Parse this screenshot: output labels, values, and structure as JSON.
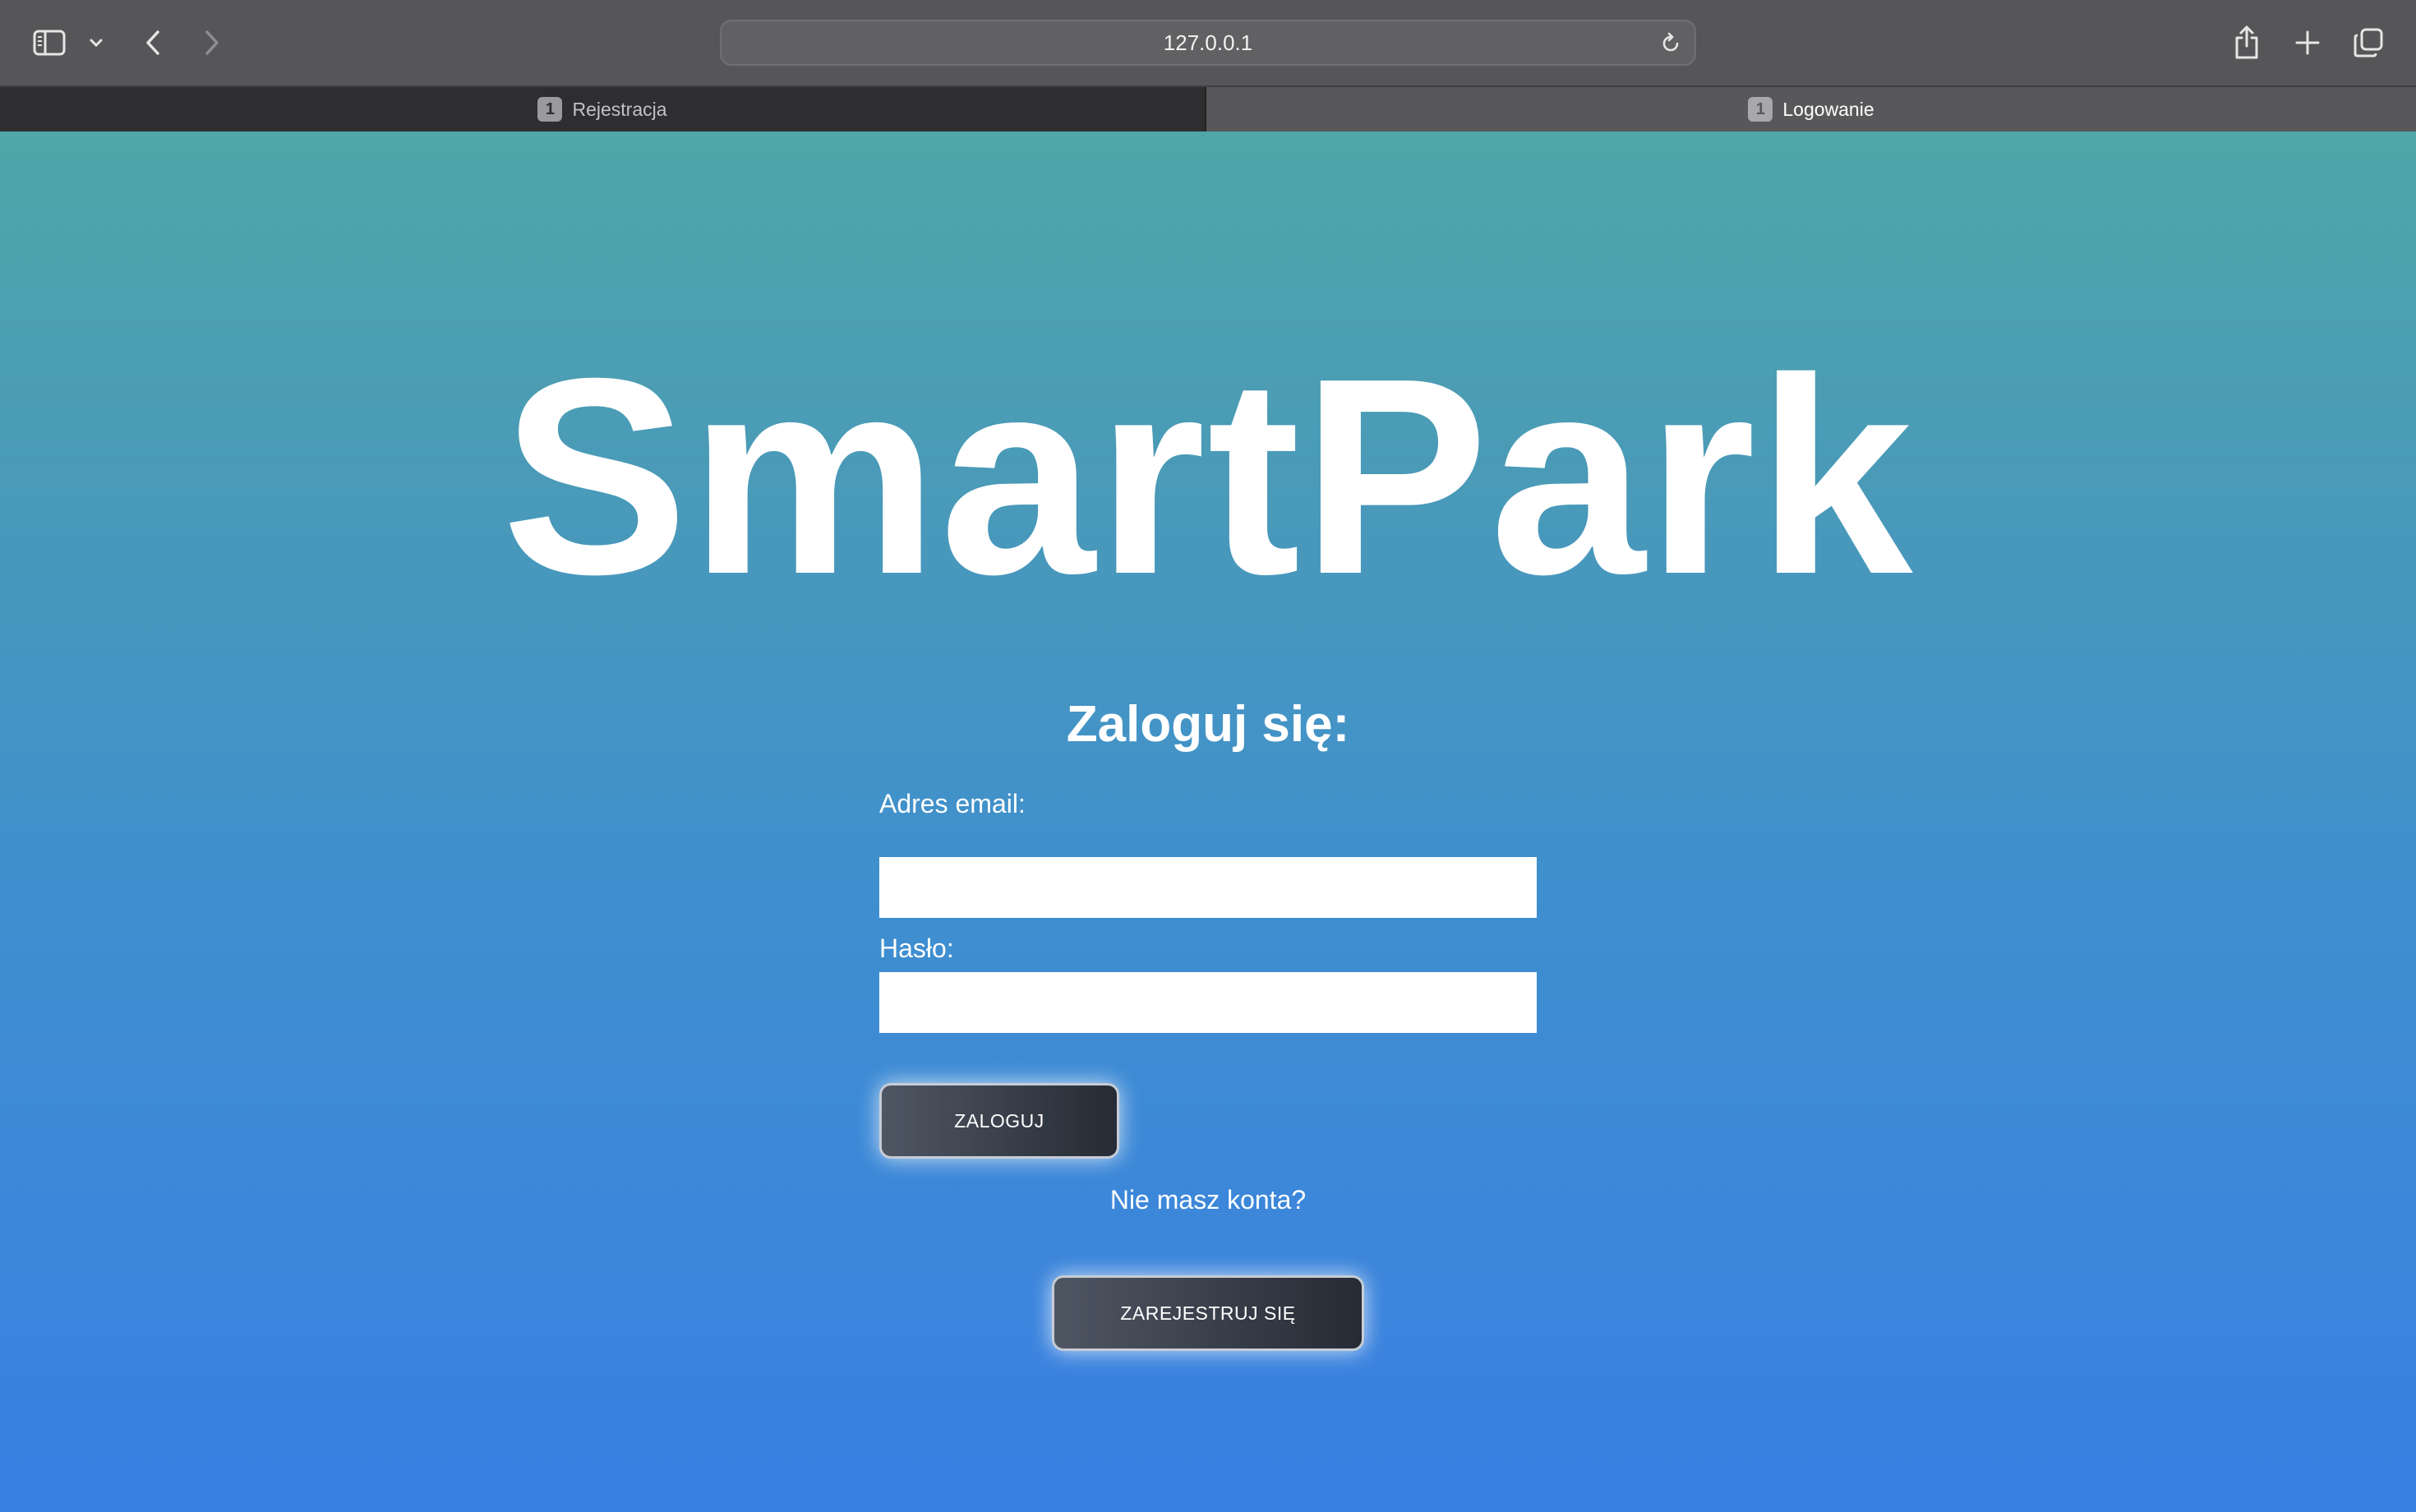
{
  "browser": {
    "url": "127.0.0.1",
    "tabs": [
      {
        "badge": "1",
        "label": "Rejestracja",
        "active": false
      },
      {
        "badge": "1",
        "label": "Logowanie",
        "active": true
      }
    ],
    "icons": {
      "sidebar": "sidebar-icon",
      "sidebar_menu": "chevron-down-icon",
      "back": "chevron-left-icon",
      "forward": "chevron-right-icon",
      "reload": "reload-icon",
      "share": "share-icon",
      "new_tab": "plus-icon",
      "tab_overview": "tabs-overview-icon"
    }
  },
  "page": {
    "brand": "SmartPark",
    "form_title": "Zaloguj się:",
    "email_label": "Adres email:",
    "email_value": "",
    "password_label": "Hasło:",
    "password_value": "",
    "login_button": "ZALOGUJ",
    "no_account_text": "Nie masz konta?",
    "register_button": "ZAREJESTRUJ SIĘ"
  },
  "colors": {
    "gradient_top": "#50a6a8",
    "gradient_bottom": "#3a7fe3",
    "button_dark": "#2b303a",
    "chrome": "#565658"
  }
}
